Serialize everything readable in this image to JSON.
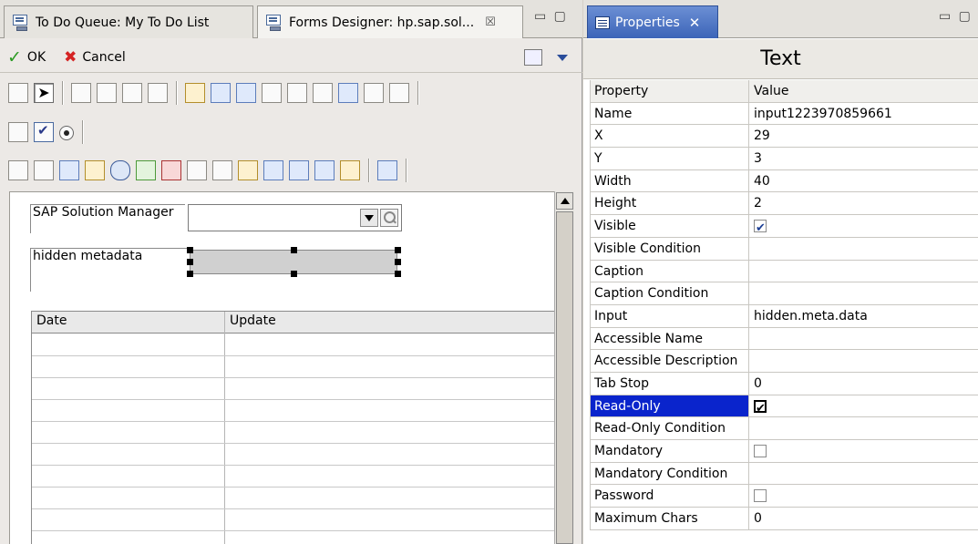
{
  "editor": {
    "tabs": [
      {
        "label": "To Do Queue: My To Do List"
      },
      {
        "label": "Forms Designer: hp.sap.sol...",
        "close": "☒"
      }
    ],
    "window_controls": "▭ ▢",
    "actions": {
      "ok_label": "OK",
      "cancel_label": "Cancel"
    },
    "canvas": {
      "sap_label": "SAP Solution Manager",
      "hidden_label": "hidden metadata",
      "table_headers": [
        "Date",
        "Update"
      ]
    }
  },
  "properties": {
    "tab_label": "Properties",
    "tab_close": "✕",
    "window_controls": "▭ ▢",
    "title": "Text",
    "header": {
      "property": "Property",
      "value": "Value"
    },
    "rows": [
      {
        "name": "Name",
        "value": "input1223970859661"
      },
      {
        "name": "X",
        "value": "29"
      },
      {
        "name": "Y",
        "value": "3"
      },
      {
        "name": "Width",
        "value": "40"
      },
      {
        "name": "Height",
        "value": "2"
      },
      {
        "name": "Visible",
        "checkbox": "checked"
      },
      {
        "name": "Visible Condition",
        "value": ""
      },
      {
        "name": "Caption",
        "value": ""
      },
      {
        "name": "Caption Condition",
        "value": ""
      },
      {
        "name": "Input",
        "value": "hidden.meta.data"
      },
      {
        "name": "Accessible Name",
        "value": ""
      },
      {
        "name": "Accessible Description",
        "value": ""
      },
      {
        "name": "Tab Stop",
        "value": "0"
      },
      {
        "name": "Read-Only",
        "checkbox": "checked-bold",
        "selected": true
      },
      {
        "name": "Read-Only Condition",
        "value": ""
      },
      {
        "name": "Mandatory",
        "checkbox": "unchecked"
      },
      {
        "name": "Mandatory Condition",
        "value": ""
      },
      {
        "name": "Password",
        "checkbox": "unchecked"
      },
      {
        "name": "Maximum Chars",
        "value": "0"
      }
    ],
    "selection_color": "#0a24cc"
  }
}
